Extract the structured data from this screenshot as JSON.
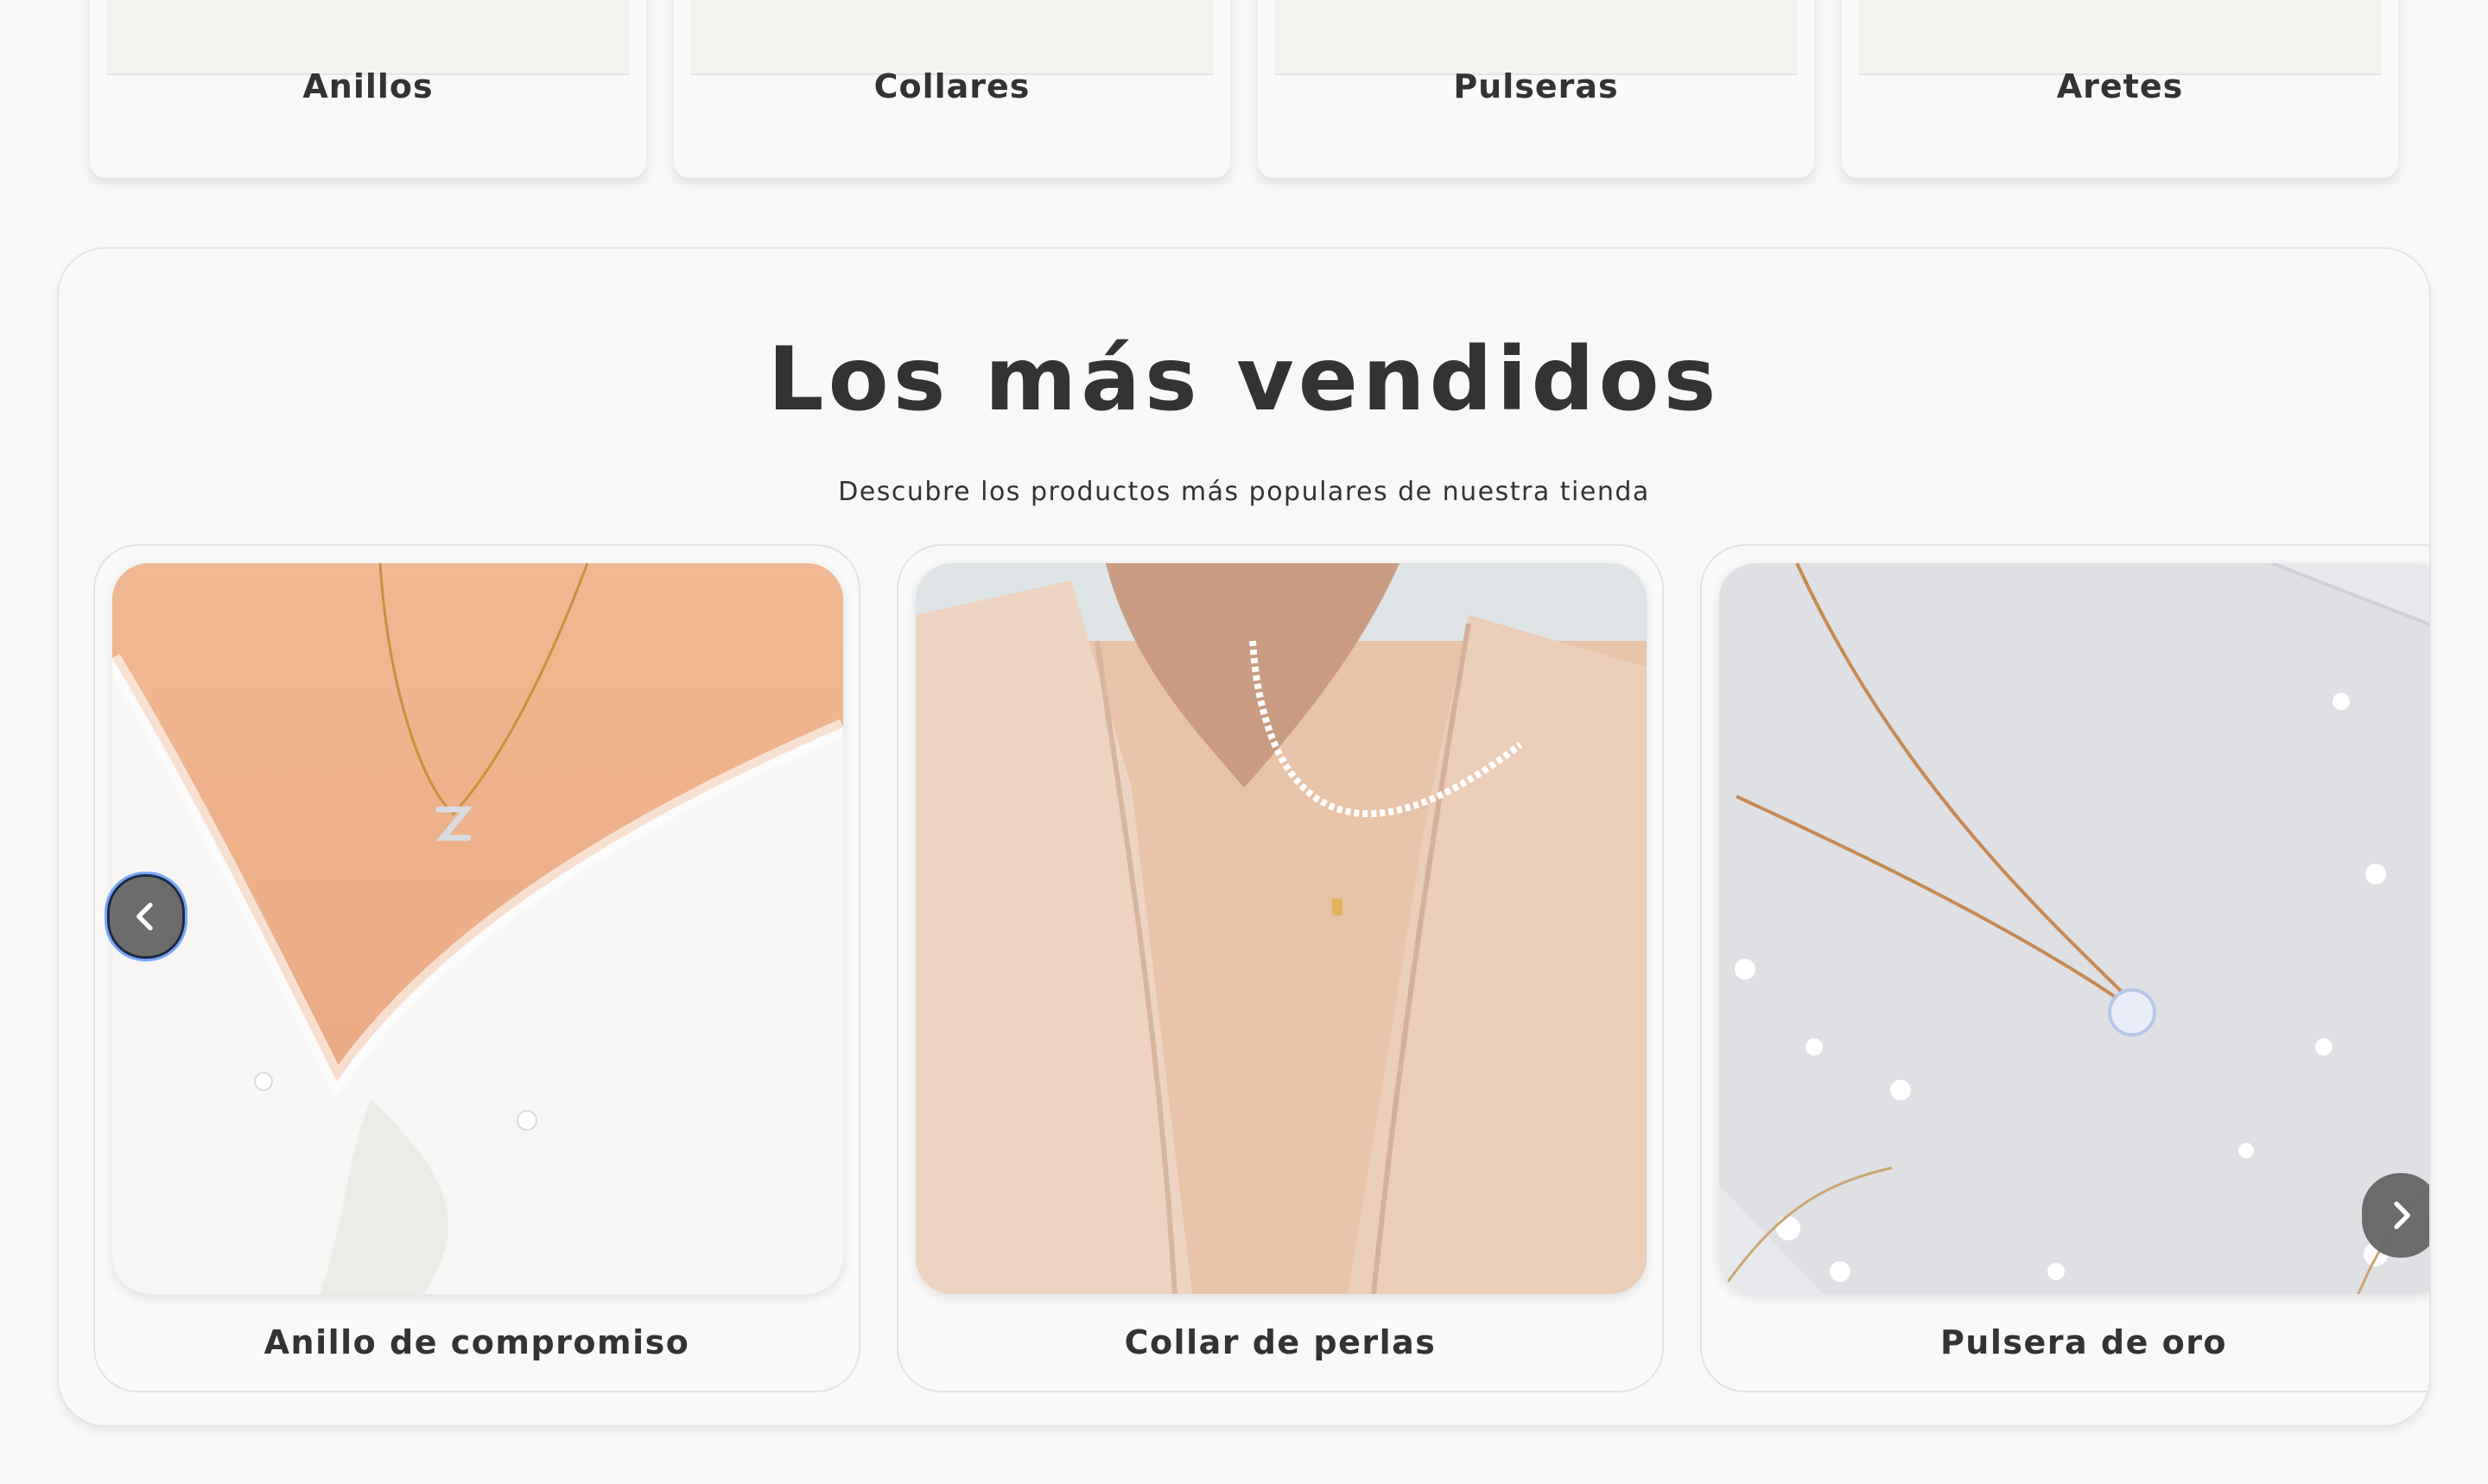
{
  "categories": [
    {
      "label": "Anillos"
    },
    {
      "label": "Collares"
    },
    {
      "label": "Pulseras"
    },
    {
      "label": "Aretes"
    }
  ],
  "best_sellers": {
    "title": "Los más vendidos",
    "subtitle": "Descubre los productos más populares de nuestra tienda",
    "products": [
      {
        "name": "Anillo de compromiso",
        "image": "model-white-sweater-gold-initial-necklace"
      },
      {
        "name": "Collar de perlas",
        "image": "model-beige-shirt-pearl-bead-necklace"
      },
      {
        "name": "Pulsera de oro",
        "image": "gold-chain-crystal-pendant-on-marble"
      }
    ],
    "prev_icon": "chevron-left-icon",
    "next_icon": "chevron-right-icon"
  },
  "colors": {
    "background": "#f8f8f8",
    "text": "#333333",
    "arrow": "#646464"
  }
}
